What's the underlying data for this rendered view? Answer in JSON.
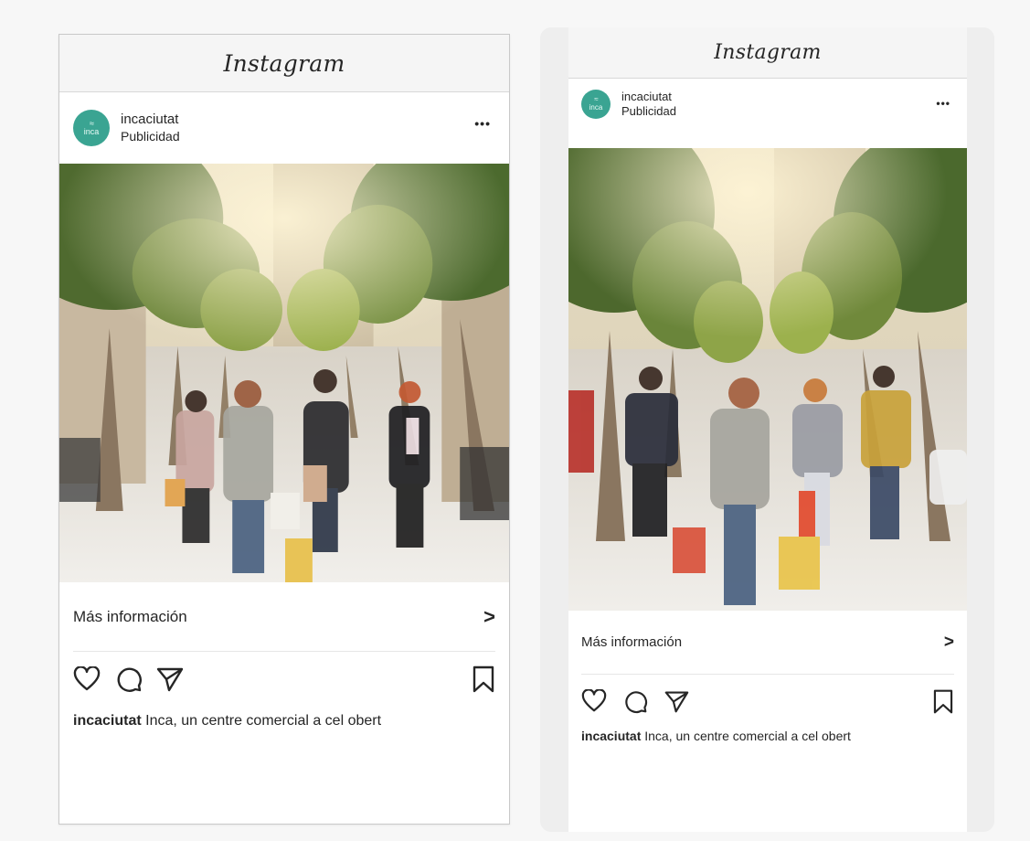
{
  "posts": [
    {
      "app_title": "Instagram",
      "account_name": "incaciutat",
      "account_subtitle": "Publicidad",
      "avatar_text": "inca",
      "cta_label": "Más información",
      "cta_chevron": ">",
      "more_menu": "•••",
      "caption_user": "incaciutat",
      "caption_text": "Inca, un centre comercial a cel obert"
    },
    {
      "app_title": "Instagram",
      "account_name": "incaciutat",
      "account_subtitle": "Publicidad",
      "avatar_text": "inca",
      "cta_label": "Más información",
      "cta_chevron": ">",
      "more_menu": "•••",
      "caption_user": "incaciutat",
      "caption_text": "Inca, un centre comercial a cel obert"
    }
  ],
  "colors": {
    "brand_avatar": "#3aa492",
    "header_bg": "#f5f5f5",
    "text": "#262626"
  },
  "icons": [
    "heart-icon",
    "comment-icon",
    "share-icon",
    "bookmark-icon",
    "more-icon",
    "chevron-right-icon"
  ]
}
